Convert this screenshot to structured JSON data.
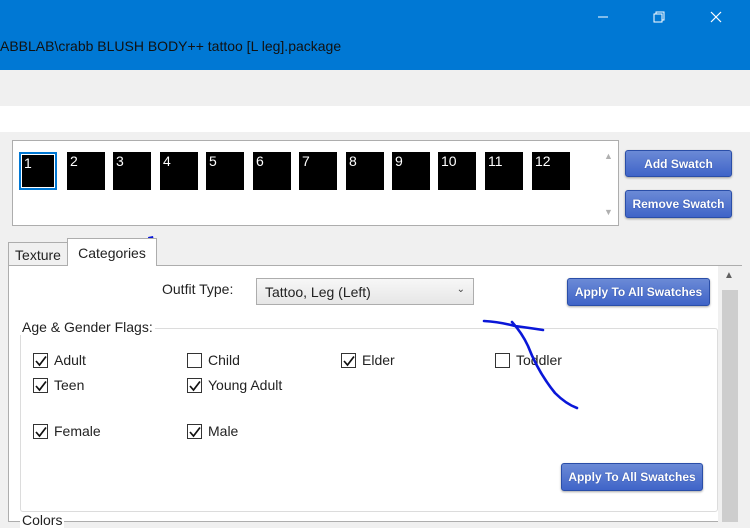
{
  "window": {
    "title": "ABBLAB\\crabb BLUSH BODY++ tattoo [L leg].package"
  },
  "swatches": {
    "items": [
      "1",
      "2",
      "3",
      "4",
      "5",
      "6",
      "7",
      "8",
      "9",
      "10",
      "11",
      "12"
    ],
    "selected": "1",
    "add_label": "Add Swatch",
    "remove_label": "Remove Swatch"
  },
  "tabs": [
    {
      "label": "Texture",
      "active": false
    },
    {
      "label": "Categories",
      "active": true
    }
  ],
  "categories": {
    "outfit_type_label": "Outfit Type:",
    "outfit_type_value": "Tattoo, Leg (Left)",
    "apply_label_top": "Apply To All Swatches",
    "apply_label_bottom": "Apply To All Swatches",
    "group_title": "Age & Gender Flags:",
    "flags": [
      {
        "label": "Adult",
        "checked": true
      },
      {
        "label": "Child",
        "checked": false
      },
      {
        "label": "Elder",
        "checked": true
      },
      {
        "label": "Toddler",
        "checked": false
      },
      {
        "label": "Teen",
        "checked": true
      },
      {
        "label": "Young Adult",
        "checked": true
      },
      {
        "label": "Female",
        "checked": true
      },
      {
        "label": "Male",
        "checked": true
      }
    ],
    "colors_label": "Colors"
  },
  "colors": {
    "titlebar": "#0078d4",
    "accent_button": "#4a6fcf",
    "annotation_ink": "#0a17d8"
  }
}
